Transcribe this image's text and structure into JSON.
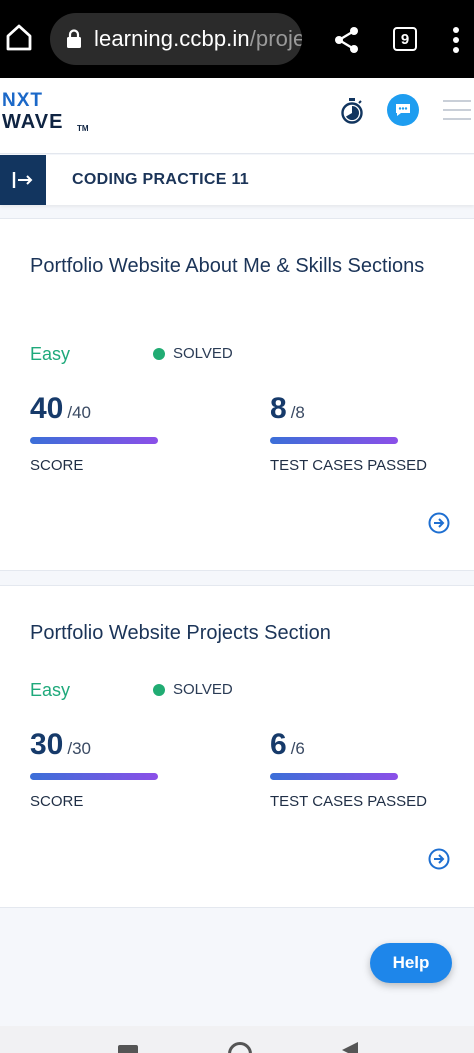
{
  "browser": {
    "url_domain": "learning.ccbp.in",
    "url_path": "/proje",
    "tab_count": "9"
  },
  "header": {
    "logo_top": "NXT",
    "logo_bottom": "WAVE",
    "logo_tm": "TM"
  },
  "practice": {
    "title": "CODING PRACTICE 11"
  },
  "cards": [
    {
      "title": "Portfolio Website About Me & Skills Sections",
      "difficulty": "Easy",
      "status": "SOLVED",
      "score_value": "40",
      "score_total": "/40",
      "score_label": "SCORE",
      "tests_value": "8",
      "tests_total": "/8",
      "tests_label": "TEST CASES PASSED",
      "score_progress": 1.0,
      "tests_progress": 1.0
    },
    {
      "title": "Portfolio Website Projects Section",
      "difficulty": "Easy",
      "status": "SOLVED",
      "score_value": "30",
      "score_total": "/30",
      "score_label": "SCORE",
      "tests_value": "6",
      "tests_total": "/6",
      "tests_label": "TEST CASES PASSED",
      "score_progress": 1.0,
      "tests_progress": 1.0
    }
  ],
  "help": {
    "label": "Help"
  },
  "colors": {
    "accent": "#1e86ea",
    "primary_dark": "#12355f",
    "easy": "#1fa97b",
    "solved_dot": "#21ac73"
  }
}
